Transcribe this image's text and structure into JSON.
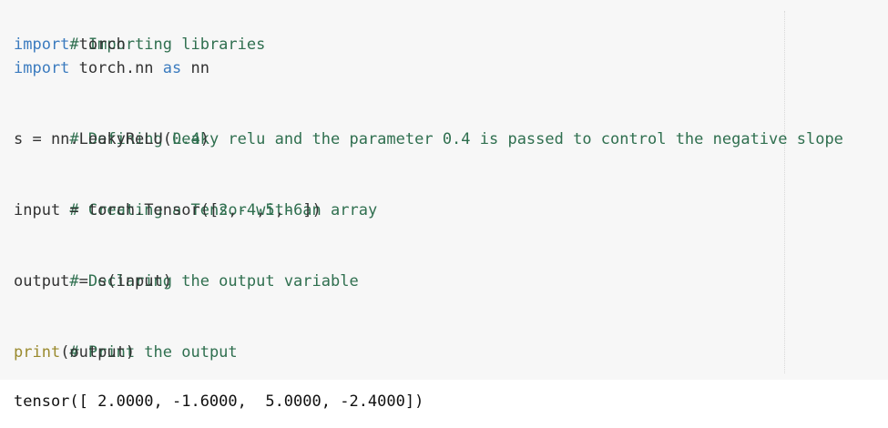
{
  "code_cell": {
    "lines": {
      "l1": {
        "comment": "# Importing libraries"
      },
      "l2": {
        "kw": "import",
        "rest": " torch"
      },
      "l3": {
        "kw1": "import",
        "mid": " torch.nn ",
        "kw2": "as",
        "rest": " nn"
      },
      "l5": {
        "comment": "# Defining Leaky relu and the parameter 0.4 is passed to control the negative slope"
      },
      "l6": {
        "pre": "s = nn.LeakyReLU(",
        "num": "0.4",
        "post": ")"
      },
      "l8": {
        "comment": "# Creating a Tensor with an array"
      },
      "l9": {
        "pre": "input = torch.Tensor([",
        "n1": "2",
        "c1": ",",
        "n2": "-4",
        "c2": ",",
        "n3": "5",
        "c3": ",",
        "n4": "-6",
        "post": "])"
      },
      "l11": {
        "comment": "# Declaring the output variable"
      },
      "l12": {
        "text": "output = s(input)"
      },
      "l14": {
        "comment": "# Print the output"
      },
      "l15": {
        "builtin": "print",
        "rest": "(output)"
      }
    }
  },
  "output": {
    "text": "tensor([ 2.0000, -1.6000,  5.0000, -2.4000])"
  }
}
